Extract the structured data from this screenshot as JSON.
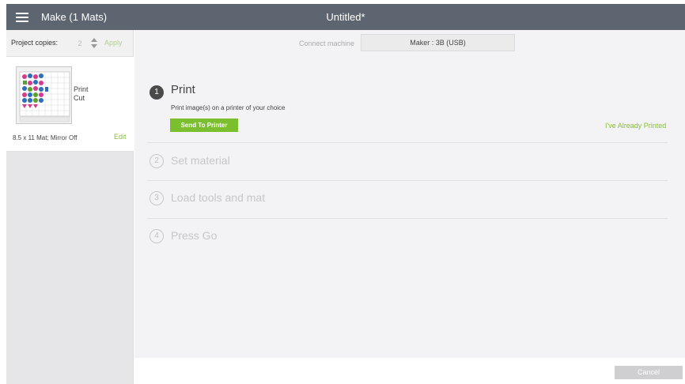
{
  "header": {
    "app_title": "Make (1 Mats)",
    "doc_title": "Untitled*"
  },
  "sidebar": {
    "copies_label": "Project copies:",
    "copies_value": "2",
    "apply_label": "Apply",
    "mat": {
      "op1": "Print",
      "op2": "Cut",
      "info": "8.5 x 11 Mat; Mirror Off",
      "edit_label": "Edit"
    }
  },
  "main": {
    "connect_label": "Connect machine",
    "machine": "Maker : 3B (USB)",
    "steps": [
      {
        "number": "1",
        "title": "Print",
        "description": "Print image(s) on a printer of your choice"
      },
      {
        "number": "2",
        "title": "Set material"
      },
      {
        "number": "3",
        "title": "Load tools and mat"
      },
      {
        "number": "4",
        "title": "Press Go"
      }
    ],
    "send_button": "Send To Printer",
    "already_printed": "I've Already Printed"
  },
  "footer": {
    "cancel_label": "Cancel"
  },
  "colors": {
    "topbar": "#5d6670",
    "accent_green": "#7bbf2f",
    "link_green": "#8bbd3c"
  }
}
